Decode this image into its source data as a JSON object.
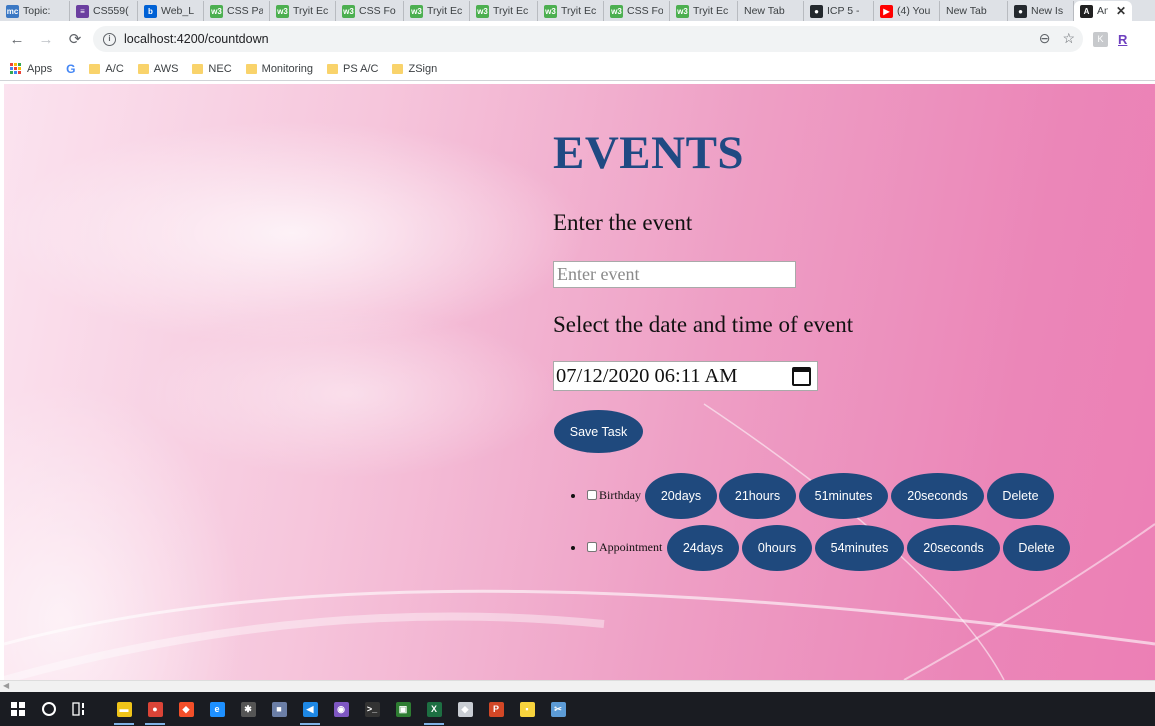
{
  "browser": {
    "tabs": [
      {
        "label": "Topic:",
        "favicon": "mc-icon",
        "color": "#3b78c4",
        "glyph": "mc"
      },
      {
        "label": "CS559(",
        "favicon": "list-icon",
        "color": "#6b3fa0",
        "glyph": "≡"
      },
      {
        "label": "Web_L",
        "favicon": "box-icon",
        "color": "#0061d5",
        "glyph": "b"
      },
      {
        "label": "CSS Pa",
        "favicon": "w3-icon",
        "color": "#4caf50",
        "glyph": "w3"
      },
      {
        "label": "Tryit Ec",
        "favicon": "w3-icon",
        "color": "#4caf50",
        "glyph": "w3"
      },
      {
        "label": "CSS Fo",
        "favicon": "w3-icon",
        "color": "#4caf50",
        "glyph": "w3"
      },
      {
        "label": "Tryit Ec",
        "favicon": "w3-icon",
        "color": "#4caf50",
        "glyph": "w3"
      },
      {
        "label": "Tryit Ec",
        "favicon": "w3-icon",
        "color": "#4caf50",
        "glyph": "w3"
      },
      {
        "label": "Tryit Ec",
        "favicon": "w3-icon",
        "color": "#4caf50",
        "glyph": "w3"
      },
      {
        "label": "CSS Fo",
        "favicon": "w3-icon",
        "color": "#4caf50",
        "glyph": "w3"
      },
      {
        "label": "Tryit Ec",
        "favicon": "w3-icon",
        "color": "#4caf50",
        "glyph": "w3"
      },
      {
        "label": "New Tab",
        "favicon": "",
        "color": "",
        "glyph": ""
      },
      {
        "label": "ICP 5 -",
        "favicon": "github-icon",
        "color": "#24292e",
        "glyph": "●"
      },
      {
        "label": "(4) You",
        "favicon": "youtube-icon",
        "color": "#ff0000",
        "glyph": "▶"
      },
      {
        "label": "New Tab",
        "favicon": "",
        "color": "",
        "glyph": ""
      },
      {
        "label": "New Is",
        "favicon": "github-icon",
        "color": "#24292e",
        "glyph": "●"
      },
      {
        "label": "An",
        "favicon": "angular-icon",
        "color": "#222",
        "glyph": "A",
        "active": true
      }
    ],
    "url": "localhost:4200/countdown",
    "bookmarks": [
      {
        "label": "A/C"
      },
      {
        "label": "AWS"
      },
      {
        "label": "NEC"
      },
      {
        "label": "Monitoring"
      },
      {
        "label": "PS A/C"
      },
      {
        "label": "ZSign"
      }
    ],
    "apps_label": "Apps",
    "google_label": "G"
  },
  "page": {
    "title": "EVENTS",
    "event_label": "Enter the event",
    "event_placeholder": "Enter event",
    "date_label": "Select the date and time of event",
    "date_value": "07/12/2020 06:11 AM",
    "save_button": "Save Task",
    "events": [
      {
        "name": "Birthday",
        "days": "20days",
        "hours": "21hours",
        "minutes": "51minutes",
        "seconds": "20seconds",
        "delete": "Delete"
      },
      {
        "name": "Appointment",
        "days": "24days",
        "hours": "0hours",
        "minutes": "54minutes",
        "seconds": "20seconds",
        "delete": "Delete"
      }
    ]
  },
  "taskbar": {
    "items": [
      {
        "name": "file-explorer-icon",
        "color": "#f0c419",
        "glyph": "▬",
        "open": true
      },
      {
        "name": "chrome-icon",
        "color": "#db4437",
        "glyph": "●",
        "open": true
      },
      {
        "name": "git-icon",
        "color": "#f34f29",
        "glyph": "◆",
        "open": false
      },
      {
        "name": "edge-icon",
        "color": "#1e90ff",
        "glyph": "e",
        "open": false
      },
      {
        "name": "settings-icon",
        "color": "#555",
        "glyph": "✱",
        "open": false
      },
      {
        "name": "camera-icon",
        "color": "#6b7ea6",
        "glyph": "■",
        "open": false
      },
      {
        "name": "vscode-icon",
        "color": "#1e88e5",
        "glyph": "◀",
        "open": true
      },
      {
        "name": "media-icon",
        "color": "#7e57c2",
        "glyph": "◉",
        "open": false
      },
      {
        "name": "terminal-icon",
        "color": "#333",
        "glyph": ">_",
        "open": false
      },
      {
        "name": "app-icon",
        "color": "#2e7d32",
        "glyph": "▣",
        "open": false
      },
      {
        "name": "excel-icon",
        "color": "#1d6f42",
        "glyph": "X",
        "open": true
      },
      {
        "name": "paint-icon",
        "color": "#c9cdd3",
        "glyph": "◆",
        "open": false
      },
      {
        "name": "powerpoint-icon",
        "color": "#d24726",
        "glyph": "P",
        "open": false
      },
      {
        "name": "sticky-notes-icon",
        "color": "#f7d33d",
        "glyph": "▪",
        "open": false
      },
      {
        "name": "snipping-icon",
        "color": "#5c9bd6",
        "glyph": "✂",
        "open": false
      }
    ]
  }
}
